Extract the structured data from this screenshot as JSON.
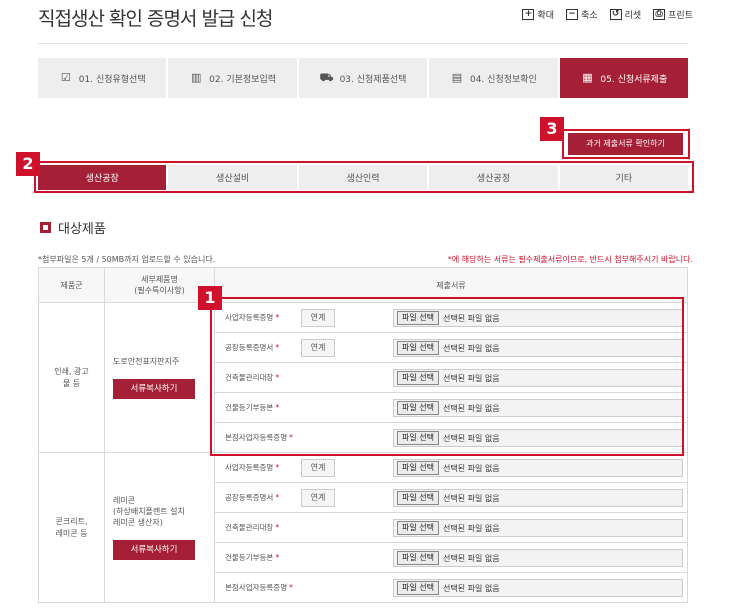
{
  "page": {
    "title": "직접생산 확인 증명서 발급 신청",
    "tools": [
      {
        "icon": "zoom-in-icon",
        "glyph": "+",
        "label": "확대"
      },
      {
        "icon": "zoom-out-icon",
        "glyph": "−",
        "label": "축소"
      },
      {
        "icon": "reset-icon",
        "glyph": "↺",
        "label": "리셋"
      },
      {
        "icon": "print-icon",
        "glyph": "⎙",
        "label": "프린트"
      }
    ]
  },
  "steps": [
    {
      "label": "01. 신청유형선택",
      "icon": "check-icon",
      "glyph": "☑"
    },
    {
      "label": "02. 기본정보입력",
      "icon": "building-icon",
      "glyph": "▥"
    },
    {
      "label": "03. 신청제품선택",
      "icon": "cart-icon",
      "glyph": "⛟"
    },
    {
      "label": "04. 신청정보확인",
      "icon": "archive-icon",
      "glyph": "▤"
    },
    {
      "label": "05. 신청서류제출",
      "icon": "clapper-icon",
      "glyph": "▦"
    }
  ],
  "active_step": 4,
  "badges": {
    "b1": "1",
    "b2": "2",
    "b3": "3"
  },
  "past_docs_button": "과거 제출서류 확인하기",
  "tabs": [
    "생산공장",
    "생산설비",
    "생산인력",
    "생산공정",
    "기타"
  ],
  "active_tab": 0,
  "section_title": "대상제품",
  "note_left": "*첨부파일은 5개 / 50MB까지 업로드할 수 있습니다.",
  "note_right": "*에 해당하는 서류는 필수제출서류이므로, 반드시 첨부해주시기 바랍니다.",
  "table": {
    "headers": {
      "group": "제품군",
      "sub": "세부제품명\n(필수특이사항)",
      "docs": "제출서류"
    },
    "groups": [
      {
        "name": "인쇄, 광고\n물 등",
        "sub": "도로안전표지판지주",
        "copy_button": "서류복사하기",
        "docs": [
          {
            "name": "사업자등록증명",
            "req": "*",
            "link": "연계",
            "file_button": "파일 선택",
            "file_status": "선택된 파일 없음"
          },
          {
            "name": "공장등록증명서",
            "req": "*",
            "link": "연계",
            "file_button": "파일 선택",
            "file_status": "선택된 파일 없음"
          },
          {
            "name": "건축물관리대장",
            "req": "*",
            "link": "",
            "file_button": "파일 선택",
            "file_status": "선택된 파일 없음"
          },
          {
            "name": "건물등기부등본",
            "req": "*",
            "link": "",
            "file_button": "파일 선택",
            "file_status": "선택된 파일 없음"
          },
          {
            "name": "본점사업자등록증명",
            "req": "*",
            "link": "",
            "file_button": "파일 선택",
            "file_status": "선택된 파일 없음"
          }
        ]
      },
      {
        "name": "콘크리트,\n레미콘 등",
        "sub": "레미콘\n(하상배치플랜트 설치\n레미콘 생산자)",
        "copy_button": "서류복사하기",
        "docs": [
          {
            "name": "사업자등록증명",
            "req": "*",
            "link": "연계",
            "file_button": "파일 선택",
            "file_status": "선택된 파일 없음"
          },
          {
            "name": "공장등록증명서",
            "req": "*",
            "link": "연계",
            "file_button": "파일 선택",
            "file_status": "선택된 파일 없음"
          },
          {
            "name": "건축물관리대장",
            "req": "*",
            "link": "",
            "file_button": "파일 선택",
            "file_status": "선택된 파일 없음"
          },
          {
            "name": "건물등기부등본",
            "req": "*",
            "link": "",
            "file_button": "파일 선택",
            "file_status": "선택된 파일 없음"
          },
          {
            "name": "본점사업자등록증명",
            "req": "*",
            "link": "",
            "file_button": "파일 선택",
            "file_status": "선택된 파일 없음"
          }
        ]
      }
    ]
  },
  "colors": {
    "accent": "#a52036",
    "highlight": "#d0112b"
  }
}
